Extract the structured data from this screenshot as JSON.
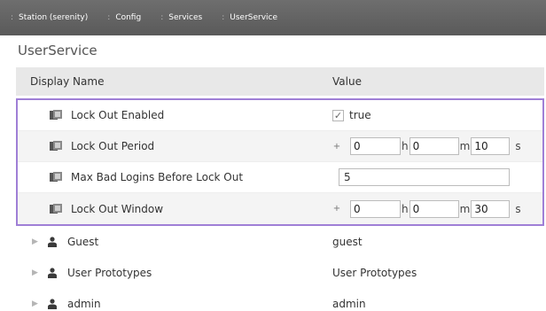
{
  "breadcrumb": [
    {
      "label": "Station (serenity)"
    },
    {
      "label": "Config"
    },
    {
      "label": "Services"
    },
    {
      "label": "UserService"
    }
  ],
  "page_title": "UserService",
  "table": {
    "headers": {
      "name": "Display Name",
      "value": "Value"
    },
    "properties": {
      "lock_out_enabled": {
        "name": "Lock Out Enabled",
        "value": "true",
        "checked": true
      },
      "lock_out_period": {
        "name": "Lock Out Period",
        "sign": "+",
        "h": "0",
        "h_unit": "h",
        "m": "0",
        "m_unit": "m",
        "s": "10",
        "s_unit": "s"
      },
      "max_bad_logins": {
        "name": "Max Bad Logins Before Lock Out",
        "value": "5"
      },
      "lock_out_window": {
        "name": "Lock Out Window",
        "sign": "+",
        "h": "0",
        "h_unit": "h",
        "m": "0",
        "m_unit": "m",
        "s": "30",
        "s_unit": "s"
      }
    },
    "users": [
      {
        "name": "Guest",
        "value": "guest"
      },
      {
        "name": "User Prototypes",
        "value": "User Prototypes"
      },
      {
        "name": "admin",
        "value": "admin"
      }
    ]
  },
  "colors": {
    "selection_border": "#9f7fd6",
    "breadcrumb_bg": "#636363"
  }
}
